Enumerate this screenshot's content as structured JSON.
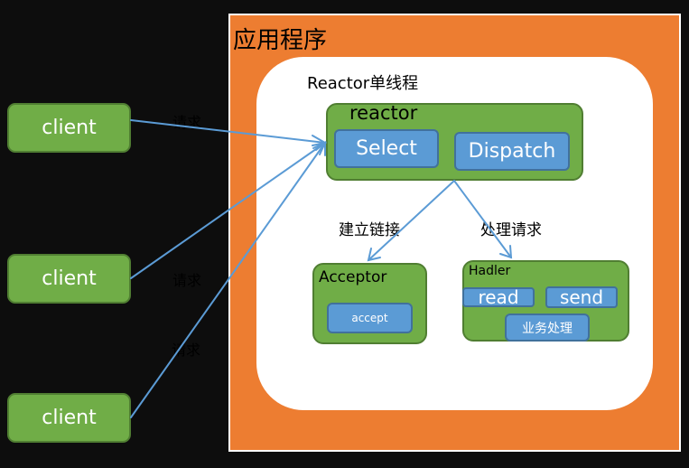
{
  "app_container": {
    "title": "应用程序"
  },
  "reactor_single_thread": {
    "title": "Reactor单线程"
  },
  "reactor": {
    "label": "reactor",
    "select_label": "Select",
    "dispatch_label": "Dispatch"
  },
  "edges": {
    "establish_connection": "建立链接",
    "handle_request": "处理请求",
    "request": "请求"
  },
  "acceptor": {
    "label": "Acceptor",
    "accept_label": "accept"
  },
  "handler": {
    "label": "Hadler",
    "read_label": "read",
    "send_label": "send",
    "business_label": "业务处理"
  },
  "clients": [
    {
      "label": "client"
    },
    {
      "label": "client"
    },
    {
      "label": "client"
    }
  ],
  "colors": {
    "background": "#0d0d0d",
    "app_container": "#ed7d31",
    "node_green": "#70ad47",
    "node_blue": "#5b9bd5",
    "arrow": "#5b9bd5"
  }
}
